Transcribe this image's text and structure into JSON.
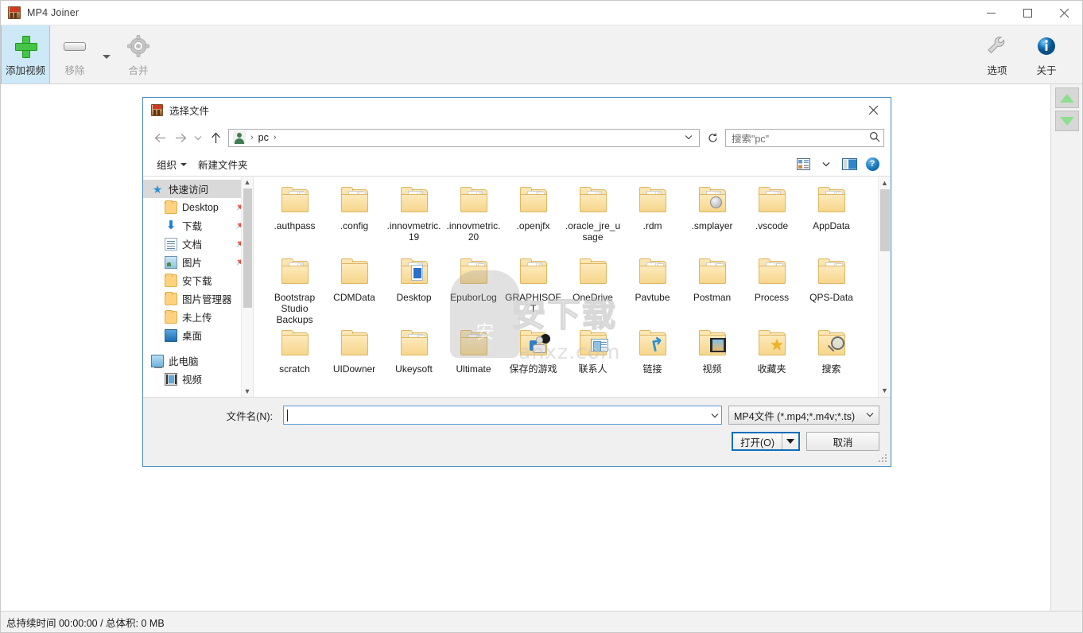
{
  "app": {
    "title": "MP4 Joiner",
    "icon": "mp4-app-icon",
    "window_controls": {
      "minimize": "—",
      "maximize": "❐",
      "close": "✕"
    },
    "toolbar": {
      "add_video": "添加视频",
      "remove": "移除",
      "merge": "合并",
      "options": "选项",
      "about": "关于"
    },
    "side_arrows": {
      "up": "move-up",
      "down": "move-down"
    },
    "status": "总持续时间 00:00:00 / 总体积: 0 MB"
  },
  "dialog": {
    "title": "选择文件",
    "close": "✕",
    "nav": {
      "back": "←",
      "forward": "→",
      "recent": "⌄",
      "up": "↑",
      "breadcrumb": [
        "pc"
      ],
      "breadcrumb_sep": "›",
      "dropdown": "⌄",
      "refresh": "↻"
    },
    "search": {
      "placeholder": "搜索\"pc\"",
      "icon": "search-icon"
    },
    "commands": {
      "organize": "组织",
      "new_folder": "新建文件夹",
      "view_icon": "view-options-icon",
      "view_caret": "⌄",
      "preview_pane": "preview-pane-icon",
      "help": "?"
    },
    "navpane": {
      "quick_access": {
        "label": "快速访问",
        "icon": "star-icon"
      },
      "items": [
        {
          "label": "Desktop",
          "icon": "folder-icon",
          "pinned": true
        },
        {
          "label": "下载",
          "icon": "download-icon",
          "pinned": true
        },
        {
          "label": "文档",
          "icon": "document-icon",
          "pinned": true
        },
        {
          "label": "图片",
          "icon": "picture-icon",
          "pinned": true
        },
        {
          "label": "安下载",
          "icon": "folder-icon",
          "pinned": false
        },
        {
          "label": "图片管理器",
          "icon": "folder-icon",
          "pinned": false
        },
        {
          "label": "未上传",
          "icon": "folder-icon",
          "pinned": false
        },
        {
          "label": "桌面",
          "icon": "desktop-icon",
          "pinned": false
        }
      ],
      "this_pc": {
        "label": "此电脑",
        "icon": "computer-icon"
      },
      "videos": {
        "label": "视频",
        "icon": "video-icon"
      }
    },
    "files": [
      {
        "name": ".authpass",
        "icon": "folder-lines"
      },
      {
        "name": ".config",
        "icon": "folder-lines"
      },
      {
        "name": ".innovmetric.19",
        "icon": "folder-paper"
      },
      {
        "name": ".innovmetric.20",
        "icon": "folder-paper"
      },
      {
        "name": ".openjfx",
        "icon": "folder-lines"
      },
      {
        "name": ".oracle_jre_usage",
        "icon": "folder-paper"
      },
      {
        "name": ".rdm",
        "icon": "folder-paper"
      },
      {
        "name": ".smplayer",
        "icon": "folder-gear"
      },
      {
        "name": ".vscode",
        "icon": "folder-paper"
      },
      {
        "name": "AppData",
        "icon": "folder-lines"
      },
      {
        "name": "Bootstrap Studio Backups",
        "icon": "folder-paper"
      },
      {
        "name": "CDMData",
        "icon": "folder-plain"
      },
      {
        "name": "Desktop",
        "icon": "folder-doc"
      },
      {
        "name": "EpuborLog",
        "icon": "folder-lines"
      },
      {
        "name": "GRAPHISOFT",
        "icon": "folder-paper"
      },
      {
        "name": "OneDrive",
        "icon": "folder-plain"
      },
      {
        "name": "Pavtube",
        "icon": "folder-lines"
      },
      {
        "name": "Postman",
        "icon": "folder-lines"
      },
      {
        "name": "Process",
        "icon": "folder-lines"
      },
      {
        "name": "QPS-Data",
        "icon": "folder-lines"
      },
      {
        "name": "scratch",
        "icon": "folder-plain"
      },
      {
        "name": "UIDowner",
        "icon": "folder-plain"
      },
      {
        "name": "Ukeysoft",
        "icon": "folder-lines"
      },
      {
        "name": "Ultimate",
        "icon": "folder-lines"
      },
      {
        "name": "保存的游戏",
        "icon": "folder-game"
      },
      {
        "name": "联系人",
        "icon": "folder-contact"
      },
      {
        "name": "链接",
        "icon": "folder-arrow"
      },
      {
        "name": "视频",
        "icon": "folder-film"
      },
      {
        "name": "收藏夹",
        "icon": "folder-star"
      },
      {
        "name": "搜索",
        "icon": "folder-search"
      }
    ],
    "footer": {
      "filename_label": "文件名(N):",
      "filename_value": "",
      "filename_dropdown": "⌄",
      "filetype": "MP4文件 (*.mp4;*.m4v;*.ts)",
      "filetype_caret": "⌄",
      "open_button": "打开(O)",
      "cancel_button": "取消"
    }
  },
  "watermark": {
    "text": "安下载",
    "url": "anxz.com",
    "badge": "安"
  },
  "colors": {
    "accent_blue": "#0d6eb8",
    "toolbar_bg": "#f2f2f2",
    "dialog_border": "#4a90c4",
    "selection": "#cde8f7",
    "folder_yellow": "#f5d58a",
    "green_plus": "#46c446"
  }
}
